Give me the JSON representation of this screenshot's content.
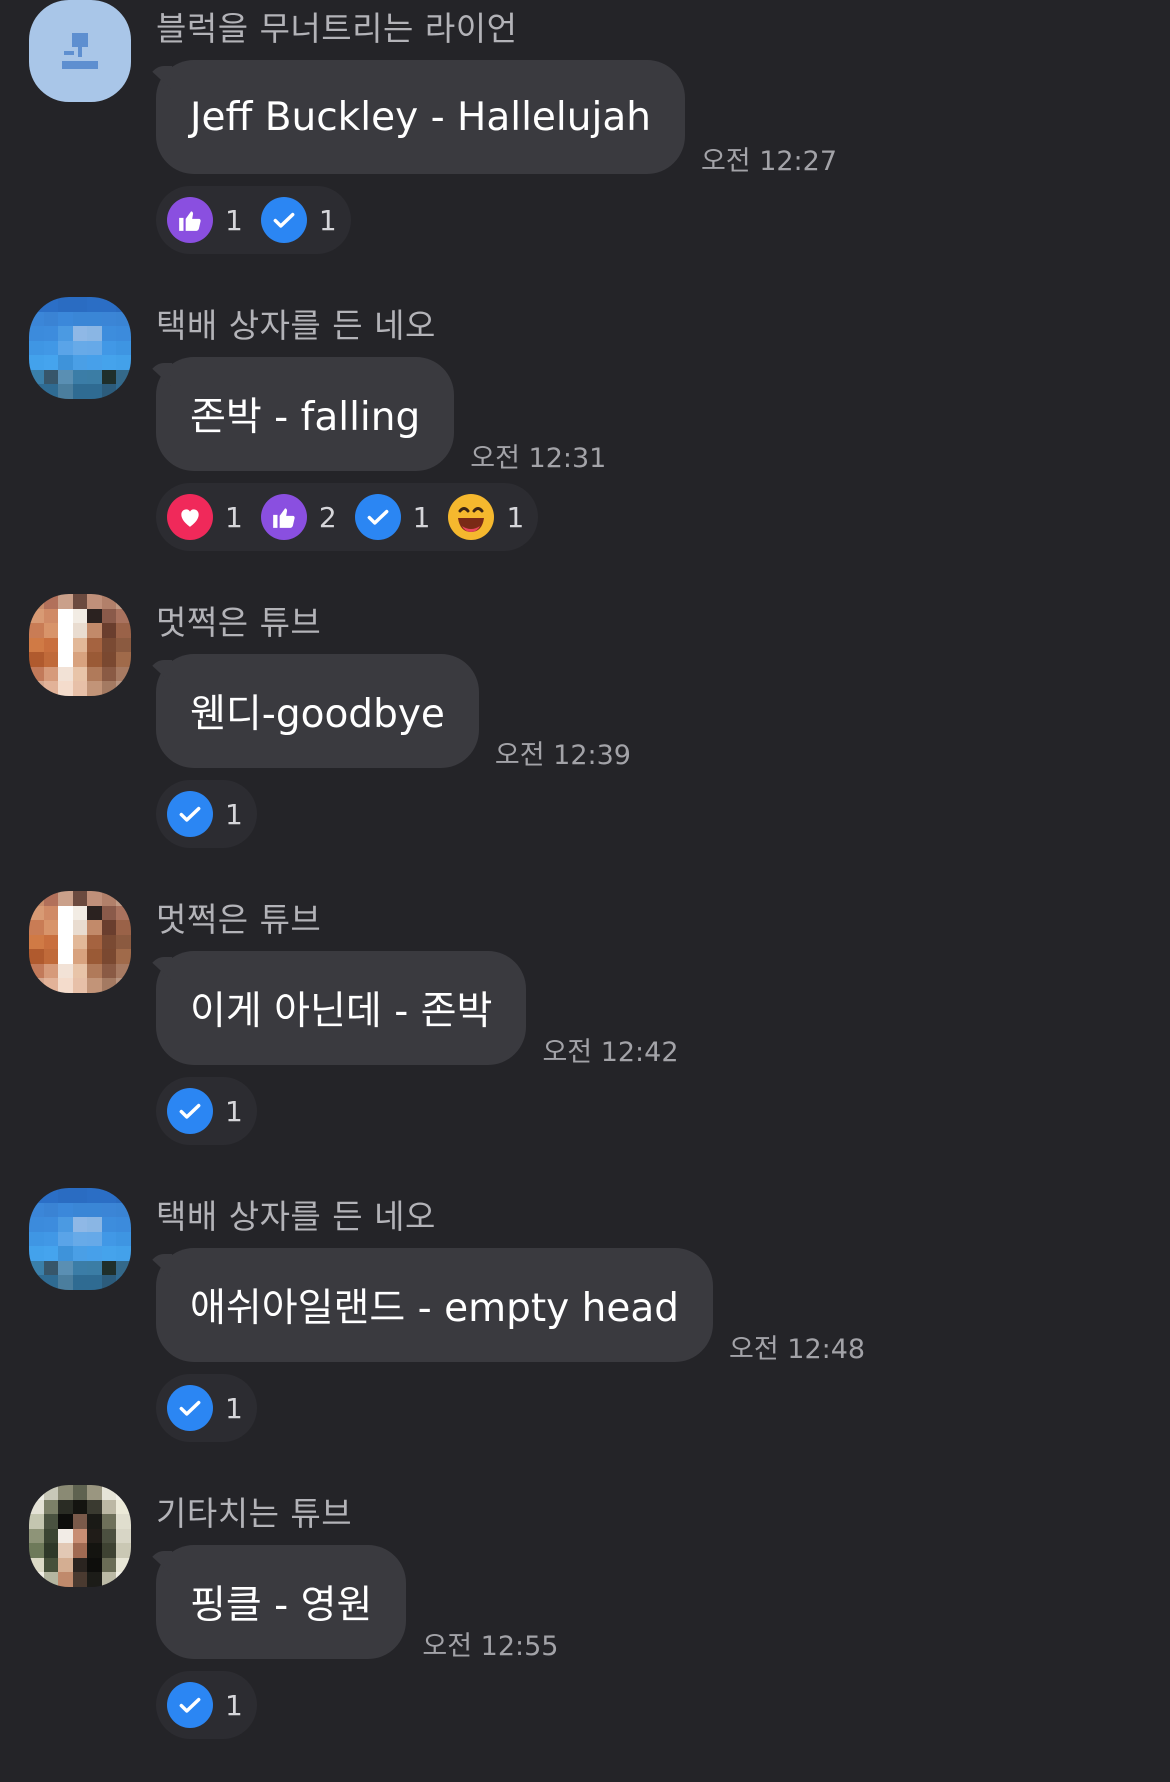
{
  "colors": {
    "background": "#242428",
    "bubble": "#3a3a3f",
    "reaction_pill": "#2c2c31",
    "sender_text": "#b3b3b8",
    "time_text": "#a3a3a8",
    "heart": "#f0295a",
    "thumbs": "#8a4fe0",
    "check": "#2b86f3",
    "laugh": "#f5b82e"
  },
  "messages": [
    {
      "sender": "블럭을 무너트리는 라이언",
      "avatar": "default-profile-icon",
      "text": "Jeff Buckley - Hallelujah",
      "time": "오전 12:27",
      "reactions": [
        {
          "icon": "thumbs-up-icon",
          "count": "1"
        },
        {
          "icon": "check-icon",
          "count": "1"
        }
      ]
    },
    {
      "sender": "택배 상자를 든 네오",
      "avatar": "pixelated-blue",
      "text": "존박 - falling",
      "time": "오전 12:31",
      "reactions": [
        {
          "icon": "heart-icon",
          "count": "1"
        },
        {
          "icon": "thumbs-up-icon",
          "count": "2"
        },
        {
          "icon": "check-icon",
          "count": "1"
        },
        {
          "icon": "laugh-icon",
          "count": "1"
        }
      ]
    },
    {
      "sender": "멋쩍은 튜브",
      "avatar": "pixelated-skin",
      "text": "웬디-goodbye",
      "time": "오전 12:39",
      "reactions": [
        {
          "icon": "check-icon",
          "count": "1"
        }
      ]
    },
    {
      "sender": "멋쩍은 튜브",
      "avatar": "pixelated-skin",
      "text": "이게 아닌데 - 존박",
      "time": "오전 12:42",
      "reactions": [
        {
          "icon": "check-icon",
          "count": "1"
        }
      ]
    },
    {
      "sender": "택배 상자를 든 네오",
      "avatar": "pixelated-blue",
      "text": "애쉬아일랜드 - empty head",
      "time": "오전 12:48",
      "reactions": [
        {
          "icon": "check-icon",
          "count": "1"
        }
      ]
    },
    {
      "sender": "기타치는 튜브",
      "avatar": "pixelated-dark",
      "text": "핑클 - 영원",
      "time": "오전 12:55",
      "reactions": [
        {
          "icon": "check-icon",
          "count": "1"
        }
      ]
    }
  ]
}
